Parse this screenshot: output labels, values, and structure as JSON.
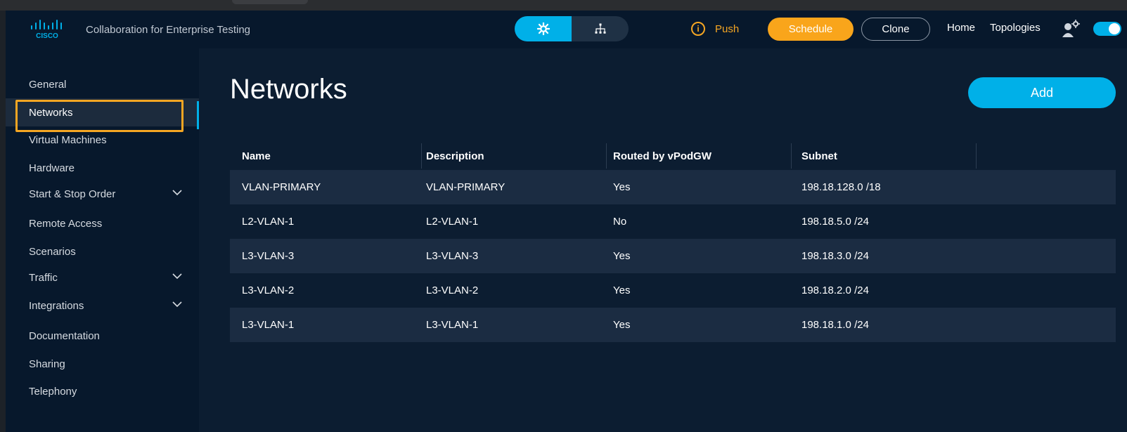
{
  "header": {
    "app_title": "Collaboration for Enterprise Testing",
    "push_label": "Push",
    "schedule_label": "Schedule",
    "clone_label": "Clone",
    "home_label": "Home",
    "topologies_label": "Topologies",
    "logo_text": "CISCO"
  },
  "sidebar": {
    "items": [
      {
        "label": "General"
      },
      {
        "label": "Networks"
      },
      {
        "label": "Virtual Machines"
      },
      {
        "label": "Hardware"
      },
      {
        "label": "Start & Stop Order"
      },
      {
        "label": "Remote Access"
      },
      {
        "label": "Scenarios"
      },
      {
        "label": "Traffic"
      },
      {
        "label": "Integrations"
      },
      {
        "label": "Documentation"
      },
      {
        "label": "Sharing"
      },
      {
        "label": "Telephony"
      }
    ]
  },
  "main": {
    "title": "Networks",
    "add_label": "Add",
    "table": {
      "headers": [
        "Name",
        "Description",
        "Routed by vPodGW",
        "Subnet"
      ],
      "rows": [
        [
          "VLAN-PRIMARY",
          "VLAN-PRIMARY",
          "Yes",
          "198.18.128.0 /18"
        ],
        [
          "L2-VLAN-1",
          "L2-VLAN-1",
          "No",
          "198.18.5.0 /24"
        ],
        [
          "L3-VLAN-3",
          "L3-VLAN-3",
          "Yes",
          "198.18.3.0 /24"
        ],
        [
          "L3-VLAN-2",
          "L3-VLAN-2",
          "Yes",
          "198.18.2.0 /24"
        ],
        [
          "L3-VLAN-1",
          "L3-VLAN-1",
          "Yes",
          "198.18.1.0 /24"
        ]
      ]
    }
  },
  "colors": {
    "accent": "#00b0e8",
    "warning": "#f9a51b",
    "focus": "#f5a623",
    "background": "#0c1d31"
  }
}
